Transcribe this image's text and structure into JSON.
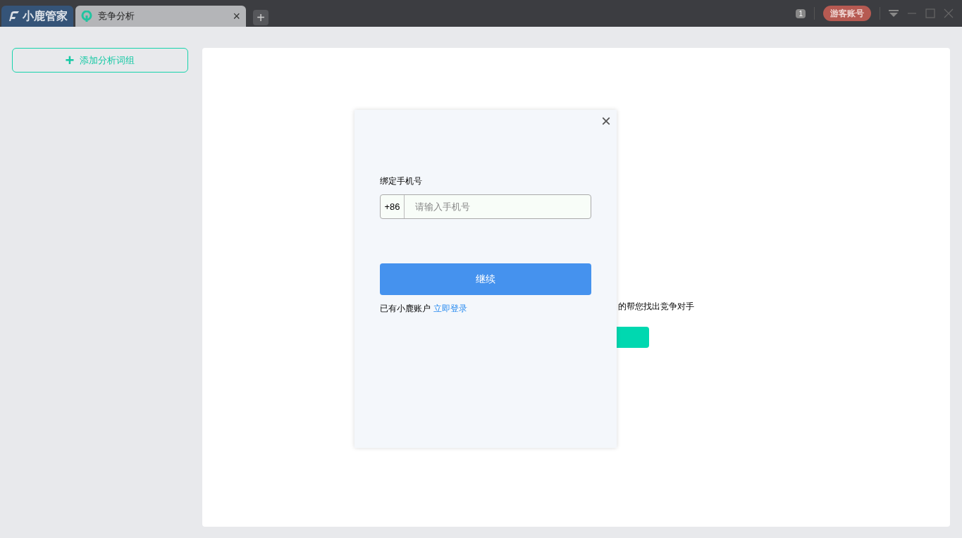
{
  "app_tab": {
    "label": "小鹿管家"
  },
  "tabs": [
    {
      "label": "竞争分析",
      "selected": true,
      "close": "×"
    }
  ],
  "new_tab": "+",
  "titlebar": {
    "badge": "1",
    "account": "游客账号"
  },
  "sidebar": {
    "add_button": {
      "icon": "+",
      "label": "添加分析词组"
    }
  },
  "empty_state": {
    "message": "的帮您找出竞争对手"
  },
  "dialog": {
    "close": "×",
    "label": "绑定手机号",
    "prefix": "+86",
    "placeholder": "请输入手机号",
    "submit": "继续",
    "footer_text": "已有小鹿账户",
    "login_link": "立即登录"
  }
}
